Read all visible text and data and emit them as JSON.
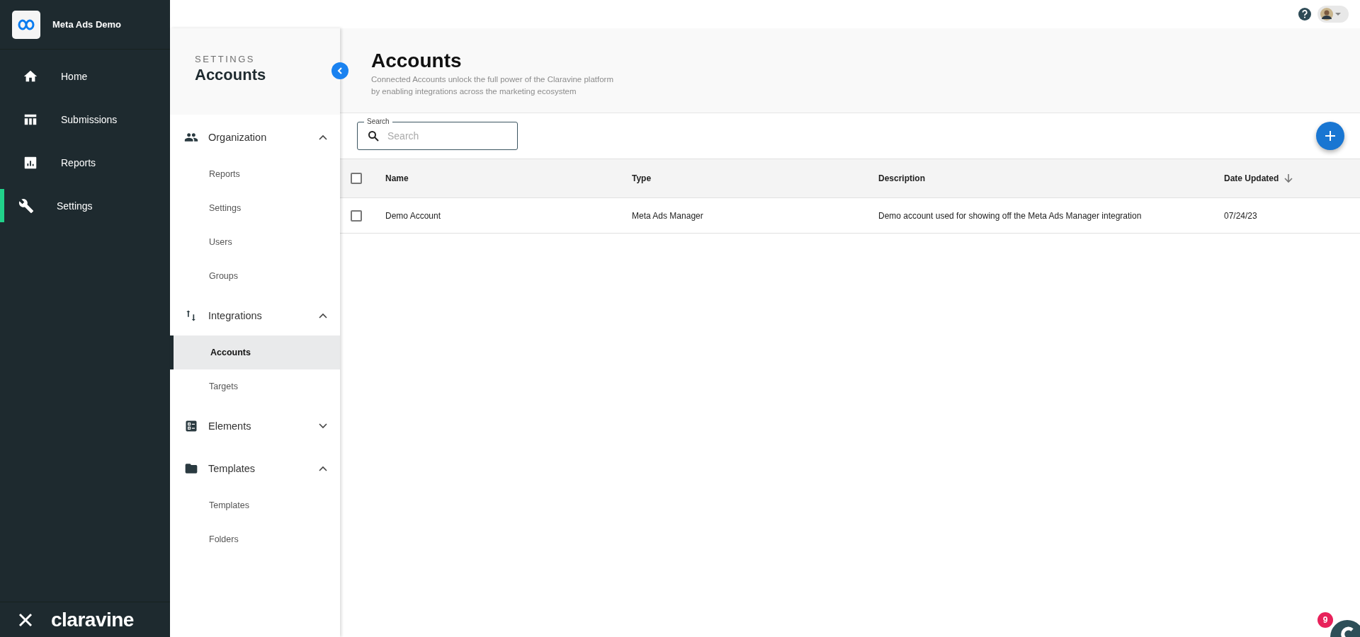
{
  "workspace": {
    "name": "Meta Ads Demo"
  },
  "nav": [
    {
      "label": "Home",
      "selected": false
    },
    {
      "label": "Submissions",
      "selected": false
    },
    {
      "label": "Reports",
      "selected": false
    },
    {
      "label": "Settings",
      "selected": true
    }
  ],
  "brand": {
    "logo": "claravine"
  },
  "settings_panel": {
    "overline": "SETTINGS",
    "title": "Accounts",
    "groups": [
      {
        "label": "Organization",
        "expanded": true,
        "children": [
          {
            "label": "Reports",
            "selected": false
          },
          {
            "label": "Settings",
            "selected": false
          },
          {
            "label": "Users",
            "selected": false
          },
          {
            "label": "Groups",
            "selected": false
          }
        ]
      },
      {
        "label": "Integrations",
        "expanded": true,
        "children": [
          {
            "label": "Accounts",
            "selected": true
          },
          {
            "label": "Targets",
            "selected": false
          }
        ]
      },
      {
        "label": "Elements",
        "expanded": false
      },
      {
        "label": "Templates",
        "expanded": true,
        "children": [
          {
            "label": "Templates",
            "selected": false
          },
          {
            "label": "Folders",
            "selected": false
          }
        ]
      }
    ]
  },
  "page": {
    "title": "Accounts",
    "subtitle_lines": [
      "Connected Accounts unlock the full power of the Claravine platform",
      "by enabling integrations across the marketing ecosystem"
    ]
  },
  "search": {
    "label": "Search",
    "placeholder": "Search"
  },
  "table": {
    "select_all_checked": false,
    "columns": [
      {
        "label": "Name",
        "sorted": false
      },
      {
        "label": "Type",
        "sorted": false
      },
      {
        "label": "Description",
        "sorted": false
      },
      {
        "label": "Date Updated",
        "sorted": true
      }
    ],
    "rows": [
      {
        "checked": false,
        "cells": [
          "Demo Account",
          "Meta Ads Manager",
          "Demo account used for showing off the Meta Ads Manager integration",
          "07/24/23"
        ]
      }
    ]
  },
  "chat": {
    "badge": "9"
  }
}
